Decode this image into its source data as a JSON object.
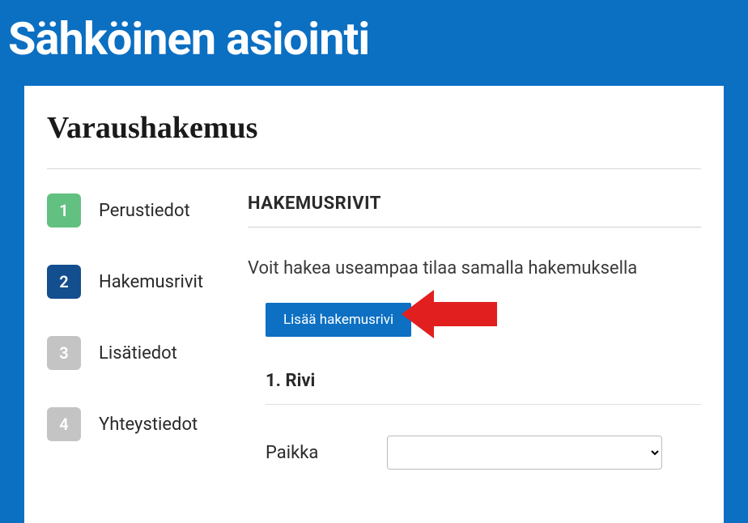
{
  "header": {
    "title": "Sähköinen asiointi"
  },
  "page": {
    "title": "Varaushakemus"
  },
  "steps": [
    {
      "number": "1",
      "label": "Perustiedot",
      "state": "completed"
    },
    {
      "number": "2",
      "label": "Hakemusrivit",
      "state": "active"
    },
    {
      "number": "3",
      "label": "Lisätiedot",
      "state": "upcoming"
    },
    {
      "number": "4",
      "label": "Yhteystiedot",
      "state": "upcoming"
    }
  ],
  "main": {
    "section_title": "HAKEMUSRIVIT",
    "info_text": "Voit hakea useampaa tilaa samalla hakemuksella",
    "add_button_label": "Lisää hakemusrivi",
    "row_heading": "1. Rivi",
    "place_label": "Paikka",
    "place_value": ""
  },
  "colors": {
    "brand_bg": "#0b6fc2",
    "completed": "#62c080",
    "active": "#134e8e",
    "upcoming": "#c4c4c4",
    "button": "#0d70c3",
    "arrow": "#e21f1f"
  }
}
